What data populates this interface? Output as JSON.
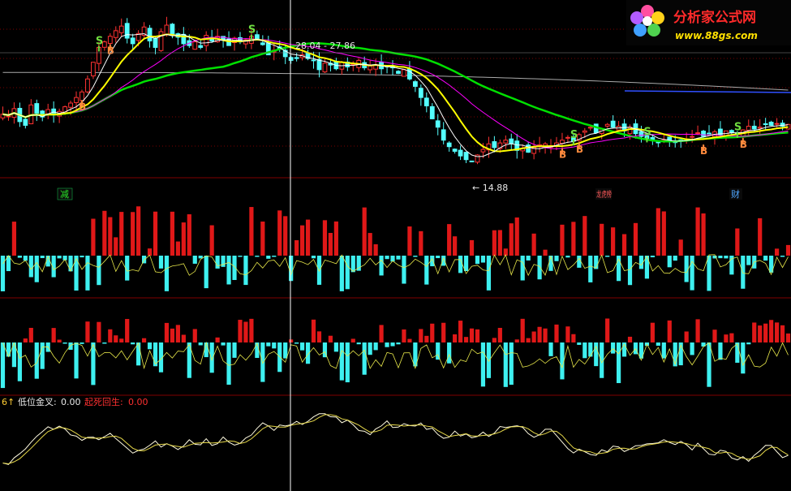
{
  "watermark": {
    "site_name": "分析家公式网",
    "url": "www.88gs.com",
    "colors": {
      "name": "#ff2a2a",
      "url": "#ffe000"
    }
  },
  "price_panel": {
    "crosshair_label": "28.04 - 27.86",
    "low_label": "← 14.88",
    "signal_labels": {
      "buy": "B",
      "sell": "S"
    },
    "event_tags": [
      {
        "text": "减",
        "color": "#29e829"
      },
      {
        "text": "龙虎榜",
        "color": "#ff5a5a"
      },
      {
        "text": "财",
        "color": "#4fa6ff"
      }
    ]
  },
  "indicator_panel": {
    "legend_prefix": "6↑",
    "legend_items": [
      {
        "label": "低位金叉:",
        "value": "0.00",
        "color": "#e8e8e8"
      },
      {
        "label": "起死回生:",
        "value": "0.00",
        "color": "#ff3030"
      }
    ]
  },
  "colors": {
    "background": "#000000",
    "up_candle": "#ff3232",
    "down_candle": "#54ffff",
    "ma5": "#ffffff",
    "ma10": "#ffff00",
    "ma20": "#ff00ff",
    "ma60": "#00e000",
    "ma_long": "#aaaaaa",
    "divider": "#800000",
    "grid": "#7a0000",
    "crosshair": "#ffffff"
  },
  "chart_data": [
    {
      "type": "candlestick",
      "y_range": [
        13.5,
        31.0
      ],
      "bar_count": 140,
      "series": [
        {
          "name": "price",
          "close_path": [
            20.0,
            19.8,
            20.6,
            19.2,
            18.8,
            21.0,
            20.1,
            19.7,
            20.5,
            19.9,
            20.3,
            20.8,
            21.2,
            21.8,
            22.4,
            23.8,
            25.6,
            27.2,
            27.8,
            28.4,
            29.0,
            29.5,
            28.2,
            27.6,
            28.7,
            29.4,
            27.9,
            27.2,
            28.9,
            29.6,
            28.6,
            28.3,
            27.6,
            27.4,
            27.8,
            27.2,
            28.5,
            27.9,
            28.4,
            28.0,
            27.4,
            28.2,
            27.8,
            28.0,
            28.4,
            28.0,
            27.5,
            26.4,
            26.9,
            27.1,
            26.2,
            25.8,
            26.0,
            26.4,
            26.0,
            25.8,
            24.8,
            25.5,
            25.3,
            24.9,
            25.6,
            25.1,
            25.4,
            25.8,
            25.0,
            25.2,
            25.3,
            24.9,
            25.1,
            25.0,
            24.4,
            24.8,
            23.8,
            23.0,
            21.8,
            20.9,
            19.5,
            18.6,
            17.2,
            16.5,
            16.0,
            15.5,
            15.1,
            14.9,
            15.6,
            16.2,
            16.8,
            16.4,
            16.9,
            17.2,
            16.8,
            16.1,
            16.3,
            15.9,
            16.4,
            16.7,
            16.8,
            16.5,
            16.9,
            17.2,
            17.5,
            17.1,
            17.8,
            18.2,
            18.6,
            18.0,
            18.4,
            18.9,
            18.6,
            18.7,
            18.2,
            18.6,
            17.9,
            17.6,
            17.4,
            17.2,
            17.0,
            17.2,
            17.1,
            17.0,
            17.2,
            17.3,
            17.6,
            18.0,
            17.6,
            17.9,
            18.1,
            17.8,
            18.2,
            18.0,
            17.9,
            18.3,
            18.7,
            18.4,
            18.6,
            18.9,
            18.8,
            19.0,
            18.7,
            18.9
          ]
        },
        {
          "name": "MA5"
        },
        {
          "name": "MA10"
        },
        {
          "name": "MA20"
        },
        {
          "name": "MA60"
        }
      ],
      "annotations": [
        "28.04 - 27.86",
        "← 14.88"
      ]
    },
    {
      "type": "bar",
      "title": "",
      "y_range": [
        -1.0,
        1.0
      ],
      "values_seed": 11
    },
    {
      "type": "bar",
      "title": "",
      "y_range": [
        -1.0,
        1.0
      ],
      "values_seed": 23
    },
    {
      "type": "line",
      "series": [
        {
          "name": "低位金叉",
          "value": 0.0
        },
        {
          "name": "起死回生",
          "value": 0.0
        }
      ],
      "y_range": [
        0,
        100
      ],
      "legend_placement": "top-left"
    }
  ]
}
